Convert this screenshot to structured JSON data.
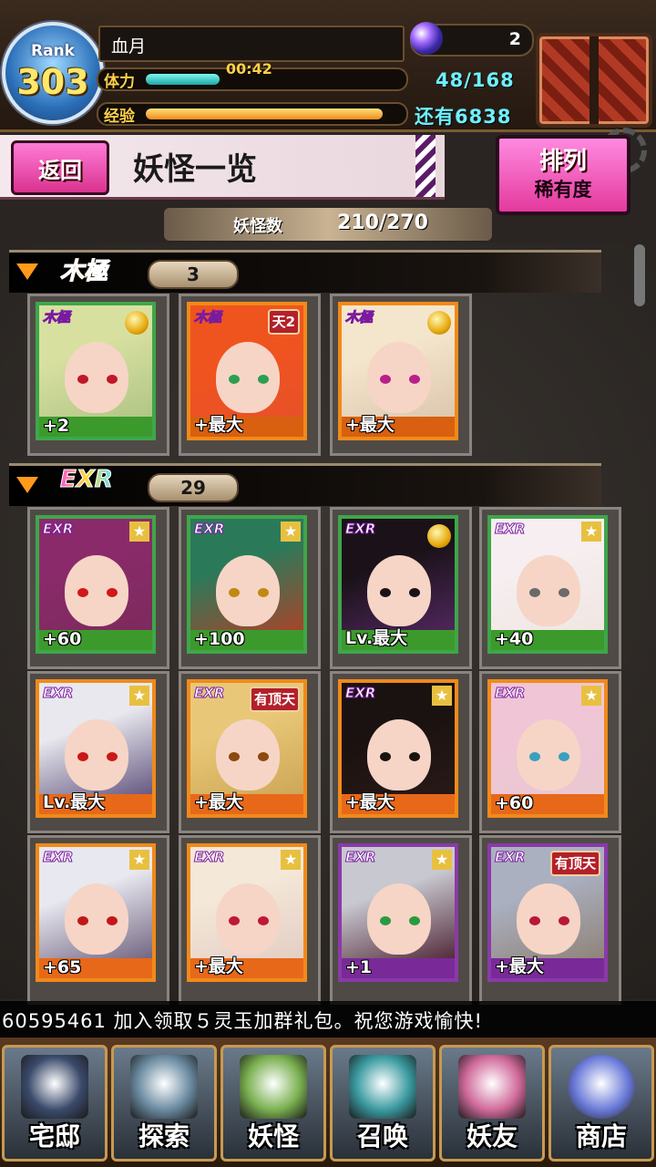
{
  "player": {
    "rank_label": "Rank",
    "rank_value": "303",
    "name": "血月",
    "gems": "2",
    "stamina_label": "体力",
    "stamina_timer": "00:42",
    "stamina_value": "48/168",
    "stamina_fraction": 0.29,
    "exp_label": "经验",
    "exp_remaining": "还有6838",
    "exp_fraction": 0.93
  },
  "header": {
    "back_label": "返回",
    "title": "妖怪一览",
    "sort_label": "排列",
    "sort_value": "稀有度"
  },
  "count": {
    "label": "妖怪数",
    "value": "210/270"
  },
  "sections": [
    {
      "rarity": "木極",
      "count": "3",
      "cards": [
        {
          "badge": "木極",
          "level": "+2",
          "frame": "#3fa64a",
          "bar": "#3c9a2c",
          "bg": "#a8c080",
          "hair": "#d8e0a0",
          "eye": "#c0182a",
          "marker": "medal",
          "tag": ""
        },
        {
          "badge": "木極",
          "level": "+最大",
          "frame": "#f08a1a",
          "bar": "#d86010",
          "bg": "#e6502a",
          "hair": "#f0541e",
          "eye": "#2aa050",
          "marker": "tag",
          "tag": "天2"
        },
        {
          "badge": "木極",
          "level": "+最大",
          "frame": "#f08a1a",
          "bar": "#d86010",
          "bg": "#d8c0a8",
          "hair": "#f4e6cc",
          "eye": "#b8208a",
          "marker": "medal",
          "tag": ""
        }
      ]
    },
    {
      "rarity": "EXR",
      "count": "29",
      "cards": [
        {
          "badge": "EXR",
          "level": "+60",
          "frame": "#3fa64a",
          "bar": "#3c9a2c",
          "bg": "#7a2a5a",
          "hair": "#8a2a6a",
          "eye": "#d01818",
          "marker": "star",
          "tag": ""
        },
        {
          "badge": "EXR",
          "level": "+100",
          "frame": "#3fa64a",
          "bar": "#3c9a2c",
          "bg": "#c03a20",
          "hair": "#2a7a5a",
          "eye": "#c08a10",
          "marker": "star",
          "tag": ""
        },
        {
          "badge": "EXR",
          "level": "Lv.最大",
          "frame": "#3fa64a",
          "bar": "#3c9a2c",
          "bg": "#5a2a6a",
          "hair": "#1a1218",
          "eye": "#1a1218",
          "marker": "medal",
          "tag": ""
        },
        {
          "badge": "EXR",
          "level": "+40",
          "frame": "#3fa64a",
          "bar": "#3c9a2c",
          "bg": "#efe4e0",
          "hair": "#f6eef0",
          "eye": "#6a6a6a",
          "marker": "star",
          "tag": ""
        },
        {
          "badge": "EXR",
          "level": "Lv.最大",
          "frame": "#f08a1a",
          "bar": "#e8681a",
          "bg": "#4a3a6a",
          "hair": "#e8e8ee",
          "eye": "#c81818",
          "marker": "star",
          "tag": ""
        },
        {
          "badge": "EXR",
          "level": "+最大",
          "frame": "#f08a1a",
          "bar": "#e8681a",
          "bg": "#c8a050",
          "hair": "#e8c878",
          "eye": "#8a4a10",
          "marker": "tag",
          "tag": "有顶天"
        },
        {
          "badge": "EXR",
          "level": "+最大",
          "frame": "#f08a1a",
          "bar": "#e8681a",
          "bg": "#2a1a18",
          "hair": "#1a1210",
          "eye": "#1a1210",
          "marker": "star",
          "tag": ""
        },
        {
          "badge": "EXR",
          "level": "+60",
          "frame": "#f08a1a",
          "bar": "#e8681a",
          "bg": "#e8c8d0",
          "hair": "#f0c6d6",
          "eye": "#3aa0c0",
          "marker": "star",
          "tag": ""
        },
        {
          "badge": "EXR",
          "level": "+65",
          "frame": "#f08a1a",
          "bar": "#e8681a",
          "bg": "#5a4a6a",
          "hair": "#e8e8f0",
          "eye": "#c01818",
          "marker": "star",
          "tag": ""
        },
        {
          "badge": "EXR",
          "level": "+最大",
          "frame": "#f08a1a",
          "bar": "#e8681a",
          "bg": "#e0c8c0",
          "hair": "#f4e8d8",
          "eye": "#c01838",
          "marker": "star",
          "tag": ""
        },
        {
          "badge": "EXR",
          "level": "+1",
          "frame": "#8a3aa8",
          "bar": "#7a2a98",
          "bg": "#3a0a1a",
          "hair": "#c8c8d0",
          "eye": "#2a9a40",
          "marker": "star",
          "tag": ""
        },
        {
          "badge": "EXR",
          "level": "+最大",
          "frame": "#8a3aa8",
          "bar": "#7a2a98",
          "bg": "#8a7a6a",
          "hair": "#aab0c0",
          "eye": "#b81838",
          "marker": "tag",
          "tag": "有顶天"
        }
      ]
    }
  ],
  "ticker": {
    "text": "60595461      加入领取５灵玉加群礼包。祝您游戏愉快!"
  },
  "nav": [
    {
      "label": "宅邸",
      "icon": "mansion-icon",
      "color": "#3a4a6a"
    },
    {
      "label": "探索",
      "icon": "magnifier-icon",
      "color": "#6a8aa0"
    },
    {
      "label": "妖怪",
      "icon": "scroll-icon",
      "color": "#7ab050"
    },
    {
      "label": "召唤",
      "icon": "pentagram-icon",
      "color": "#3a9aa0"
    },
    {
      "label": "妖友",
      "icon": "friend-icon",
      "color": "#d06a9a"
    },
    {
      "label": "商店",
      "icon": "orb-icon",
      "color": "#6a7ad8"
    }
  ]
}
